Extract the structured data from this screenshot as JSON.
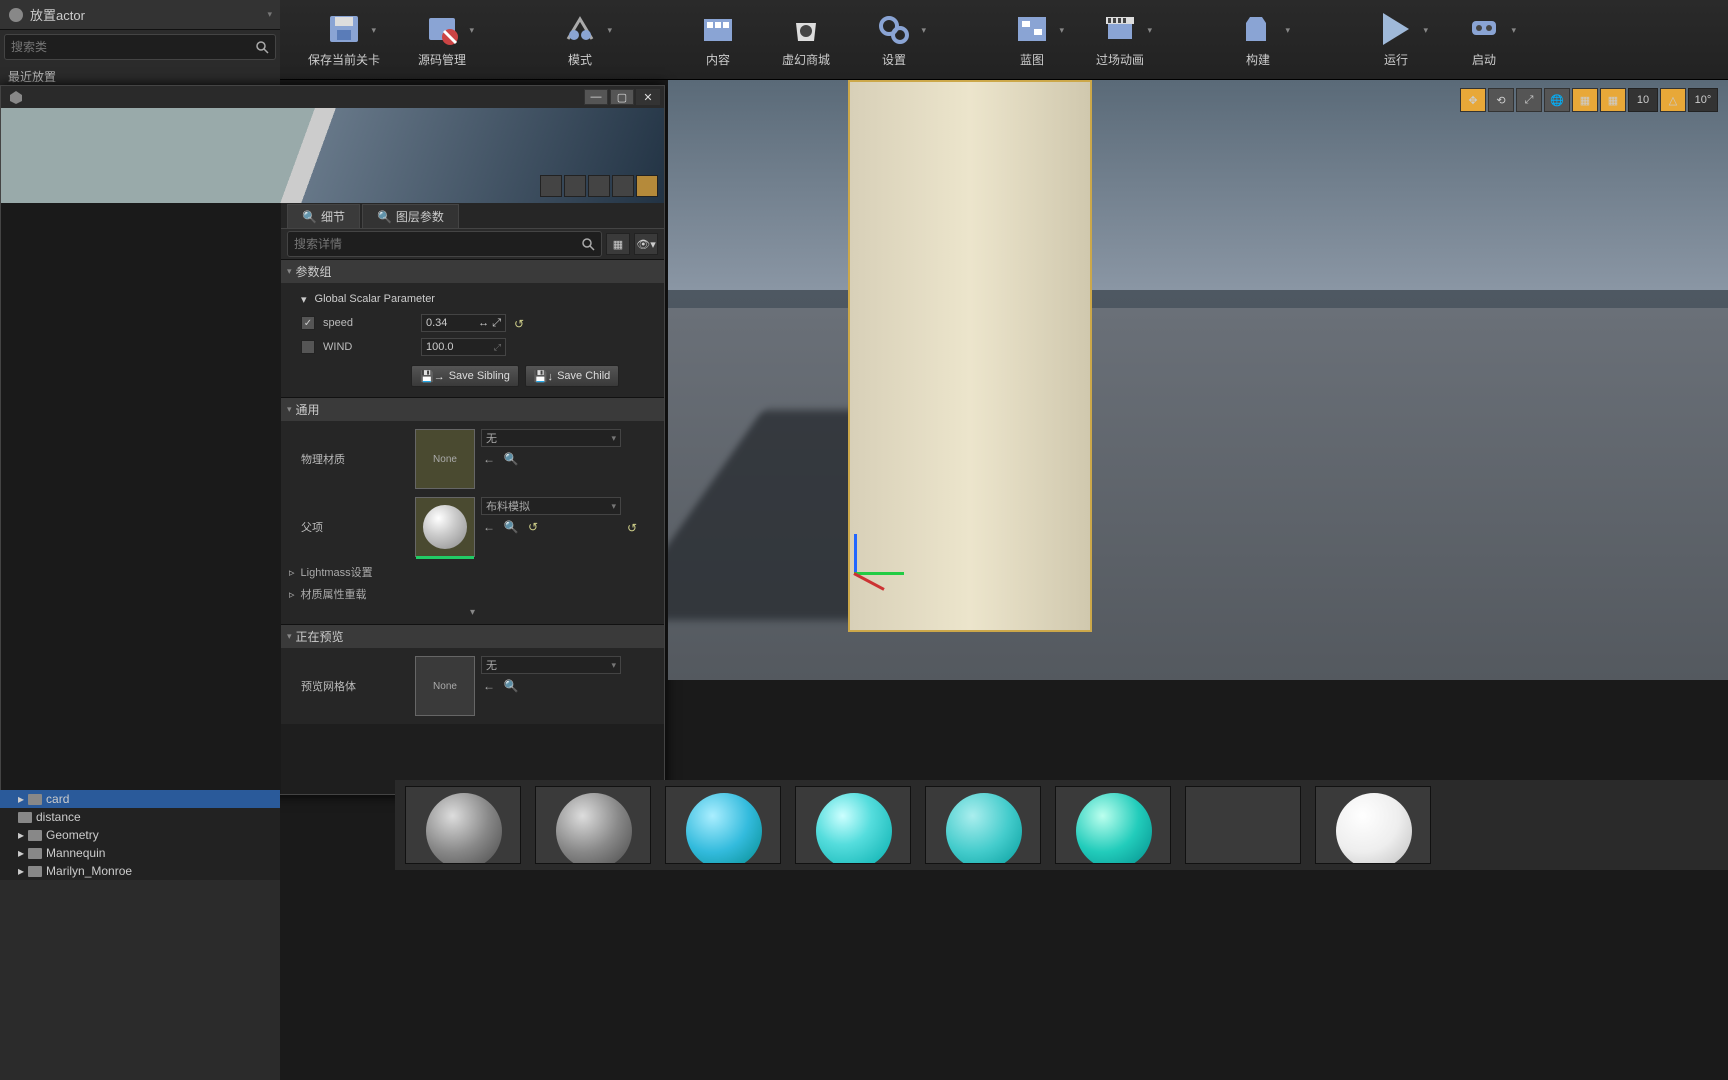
{
  "place_actor": {
    "title": "放置actor",
    "search_placeholder": "搜索类",
    "recent": "最近放置"
  },
  "toolbar": [
    {
      "label": "保存当前关卡",
      "icon": "save"
    },
    {
      "label": "源码管理",
      "icon": "source"
    },
    {
      "label": "模式",
      "icon": "modes"
    },
    {
      "label": "内容",
      "icon": "content"
    },
    {
      "label": "虚幻商城",
      "icon": "market"
    },
    {
      "label": "设置",
      "icon": "settings"
    },
    {
      "label": "蓝图",
      "icon": "blueprint"
    },
    {
      "label": "过场动画",
      "icon": "cinematic"
    },
    {
      "label": "构建",
      "icon": "build"
    },
    {
      "label": "运行",
      "icon": "play"
    },
    {
      "label": "启动",
      "icon": "launch"
    }
  ],
  "details": {
    "tabs": [
      "细节",
      "图层参数"
    ],
    "search_placeholder": "搜索详情",
    "sections": {
      "param_group": "参数组",
      "global_scalar": "Global Scalar Parameter",
      "general": "通用",
      "preview": "正在预览",
      "lightmass": "Lightmass设置",
      "material_override": "材质属性重载"
    },
    "params": {
      "speed": {
        "label": "speed",
        "value": "0.34",
        "checked": true
      },
      "wind": {
        "label": "WIND",
        "value": "100.0",
        "checked": false
      }
    },
    "save_sibling": "Save Sibling",
    "save_child": "Save Child",
    "phys_material": {
      "label": "物理材质",
      "thumb": "None",
      "dropdown": "无"
    },
    "parent": {
      "label": "父项",
      "dropdown": "布料模拟"
    },
    "preview_mesh": {
      "label": "预览网格体",
      "thumb": "None",
      "dropdown": "无"
    }
  },
  "viewport": {
    "snap1": "10",
    "snap2": "10°"
  },
  "tree": [
    "card",
    "distance",
    "Geometry",
    "Mannequin",
    "Marilyn_Monroe"
  ]
}
